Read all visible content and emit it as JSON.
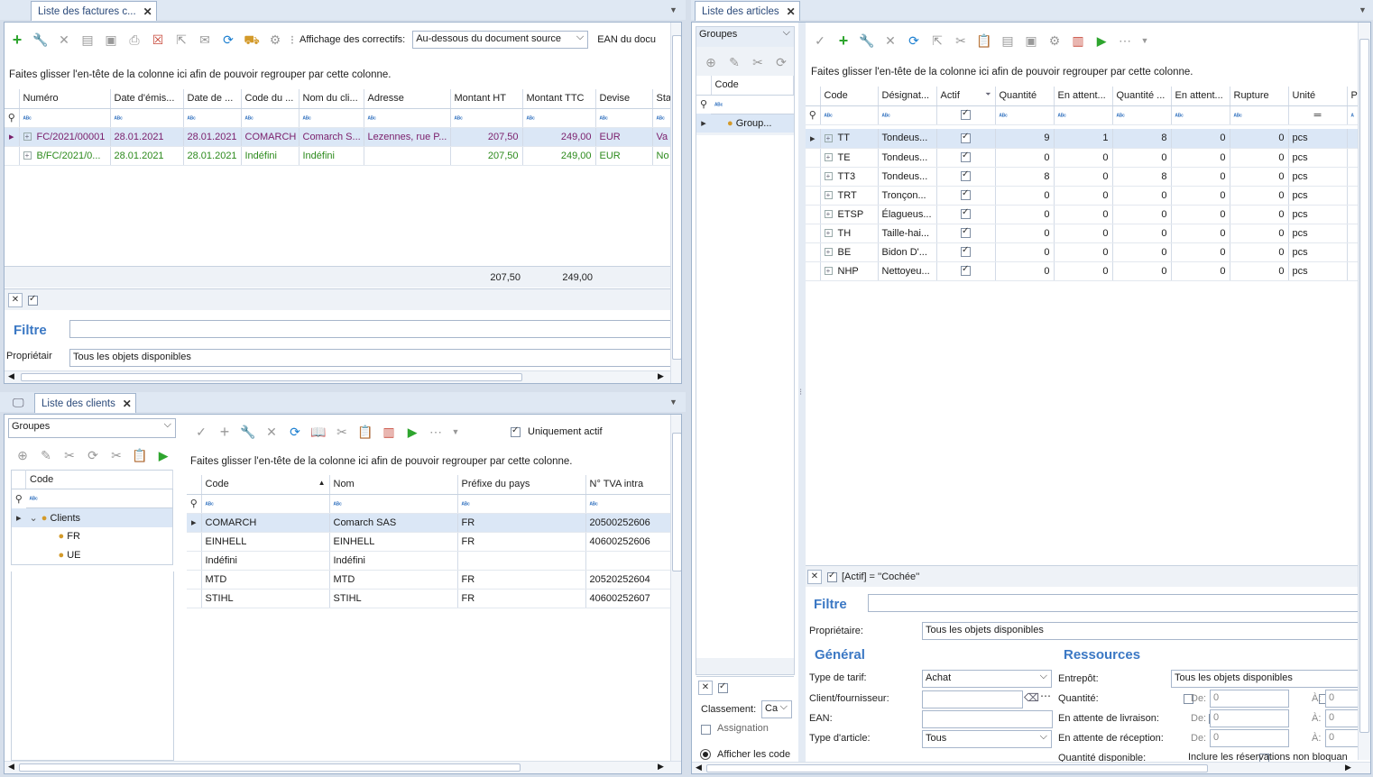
{
  "invoices": {
    "tab_title": "Liste des factures c...",
    "toolbar": {
      "correctifs_label": "Affichage des correctifs:",
      "correctifs_value": "Au-dessous du document source",
      "ean_label": "EAN du docu"
    },
    "group_hint": "Faites glisser l'en-tête de la colonne ici afin de pouvoir regrouper par cette colonne.",
    "columns": [
      "Numéro",
      "Date d'émis...",
      "Date de ...",
      "Code du ...",
      "Nom du cli...",
      "Adresse",
      "Montant HT",
      "Montant TTC",
      "Devise",
      "Sta"
    ],
    "rows": [
      [
        "FC/2021/00001",
        "28.01.2021",
        "28.01.2021",
        "COMARCH",
        "Comarch S...",
        "Lezennes, rue P...",
        "207,50",
        "249,00",
        "EUR",
        "Va"
      ],
      [
        "B/FC/2021/0...",
        "28.01.2021",
        "28.01.2021",
        "Indéfini",
        "Indéfini",
        "",
        "207,50",
        "249,00",
        "EUR",
        "No"
      ]
    ],
    "totals": {
      "ht": "207,50",
      "ttc": "249,00"
    },
    "filter_label": "Filtre",
    "owner_label": "Propriétair",
    "owner_value": "Tous les objets disponibles"
  },
  "clients": {
    "tab_title": "Liste des clients",
    "groups_label": "Groupes",
    "tree_header": "Code",
    "tree": [
      {
        "label": "Clients",
        "level": 0
      },
      {
        "label": "FR",
        "level": 1
      },
      {
        "label": "UE",
        "level": 1
      }
    ],
    "only_active_label": "Uniquement actif",
    "group_hint": "Faites glisser l'en-tête de la colonne ici afin de pouvoir regrouper par cette colonne.",
    "columns": [
      "Code",
      "Nom",
      "Préfixe du pays",
      "N° TVA intra"
    ],
    "rows": [
      [
        "COMARCH",
        "Comarch SAS",
        "FR",
        "20500252606"
      ],
      [
        "EINHELL",
        "EINHELL",
        "FR",
        "40600252606"
      ],
      [
        "Indéfini",
        "Indéfini",
        "",
        ""
      ],
      [
        "MTD",
        "MTD",
        "FR",
        "20520252604"
      ],
      [
        "STIHL",
        "STIHL",
        "FR",
        "40600252607"
      ]
    ]
  },
  "articles": {
    "tab_title": "Liste des articles",
    "groups_label": "Groupes",
    "tree_header": "Code",
    "tree_item": "Group...",
    "group_hint": "Faites glisser l'en-tête de la colonne ici afin de pouvoir regrouper par cette colonne.",
    "columns": [
      "Code",
      "Désignat...",
      "Actif",
      "Quantité",
      "En attent...",
      "Quantité ...",
      "En attent...",
      "Rupture",
      "Unité",
      "P"
    ],
    "rows": [
      [
        "TT",
        "Tondeus...",
        "9",
        "1",
        "8",
        "0",
        "0",
        "pcs"
      ],
      [
        "TE",
        "Tondeus...",
        "0",
        "0",
        "0",
        "0",
        "0",
        "pcs"
      ],
      [
        "TT3",
        "Tondeus...",
        "8",
        "0",
        "8",
        "0",
        "0",
        "pcs"
      ],
      [
        "TRT",
        "Tronçon...",
        "0",
        "0",
        "0",
        "0",
        "0",
        "pcs"
      ],
      [
        "ETSP",
        "Élagueus...",
        "0",
        "0",
        "0",
        "0",
        "0",
        "pcs"
      ],
      [
        "TH",
        "Taille-hai...",
        "0",
        "0",
        "0",
        "0",
        "0",
        "pcs"
      ],
      [
        "BE",
        "Bidon D'...",
        "0",
        "0",
        "0",
        "0",
        "0",
        "pcs"
      ],
      [
        "NHP",
        "Nettoyeu...",
        "0",
        "0",
        "0",
        "0",
        "0",
        "pcs"
      ]
    ],
    "filter_expression": "[Actif] = ''Cochée''",
    "filter_label": "Filtre",
    "owner_label": "Propriétaire:",
    "owner_value": "Tous les objets disponibles",
    "classement_label": "Classement:",
    "classement_value": "Ca",
    "assignation_label": "Assignation",
    "afficher_label": "Afficher les code",
    "general": {
      "title": "Général",
      "type_tarif_label": "Type de tarif:",
      "type_tarif_value": "Achat",
      "client_label": "Client/fournisseur:",
      "ean_label": "EAN:",
      "type_article_label": "Type d'article:",
      "type_article_value": "Tous"
    },
    "ressources": {
      "title": "Ressources",
      "entrepot_label": "Entrepôt:",
      "entrepot_value": "Tous les objets disponibles",
      "quantite_label": "Quantité:",
      "livraison_label": "En attente de livraison:",
      "reception_label": "En attente de réception:",
      "dispo_label": "Quantité disponible:",
      "reservations_label": "Inclure les réservations non bloquan",
      "de_label": "De:",
      "a_label": "À:",
      "zero": "0"
    }
  }
}
